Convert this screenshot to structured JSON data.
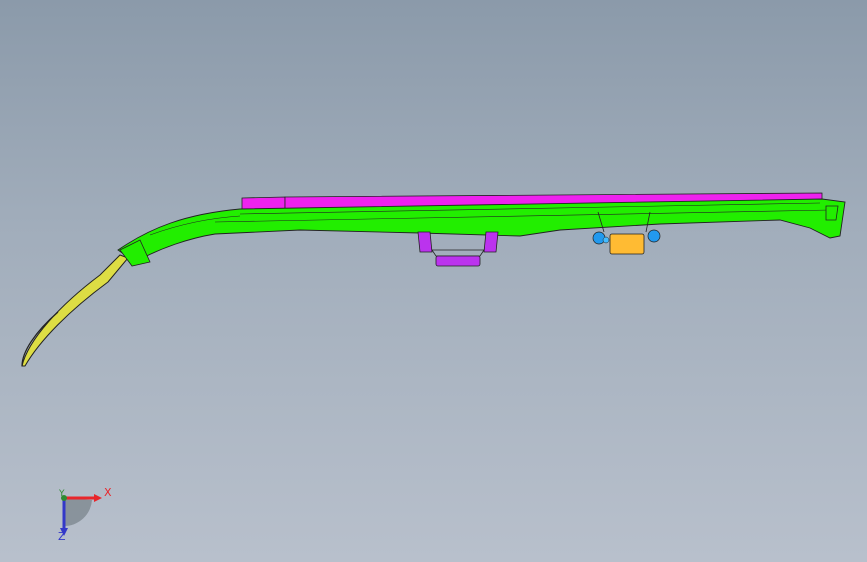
{
  "viewport": {
    "background_top": "#8b9aaa",
    "background_bottom": "#b8c0cc"
  },
  "model": {
    "rail_color": "#22ee00",
    "cover_color": "#ee22ee",
    "clip_color": "#bb33ee",
    "bracket_color": "#ffbb33",
    "cap_color": "#2299ee",
    "tail_color": "#dddd44"
  },
  "triad": {
    "x_label": "X",
    "y_label": "Y",
    "z_label": "Z",
    "x_color": "#e8262b",
    "y_color": "#2f8a34",
    "z_color": "#3338c9"
  }
}
